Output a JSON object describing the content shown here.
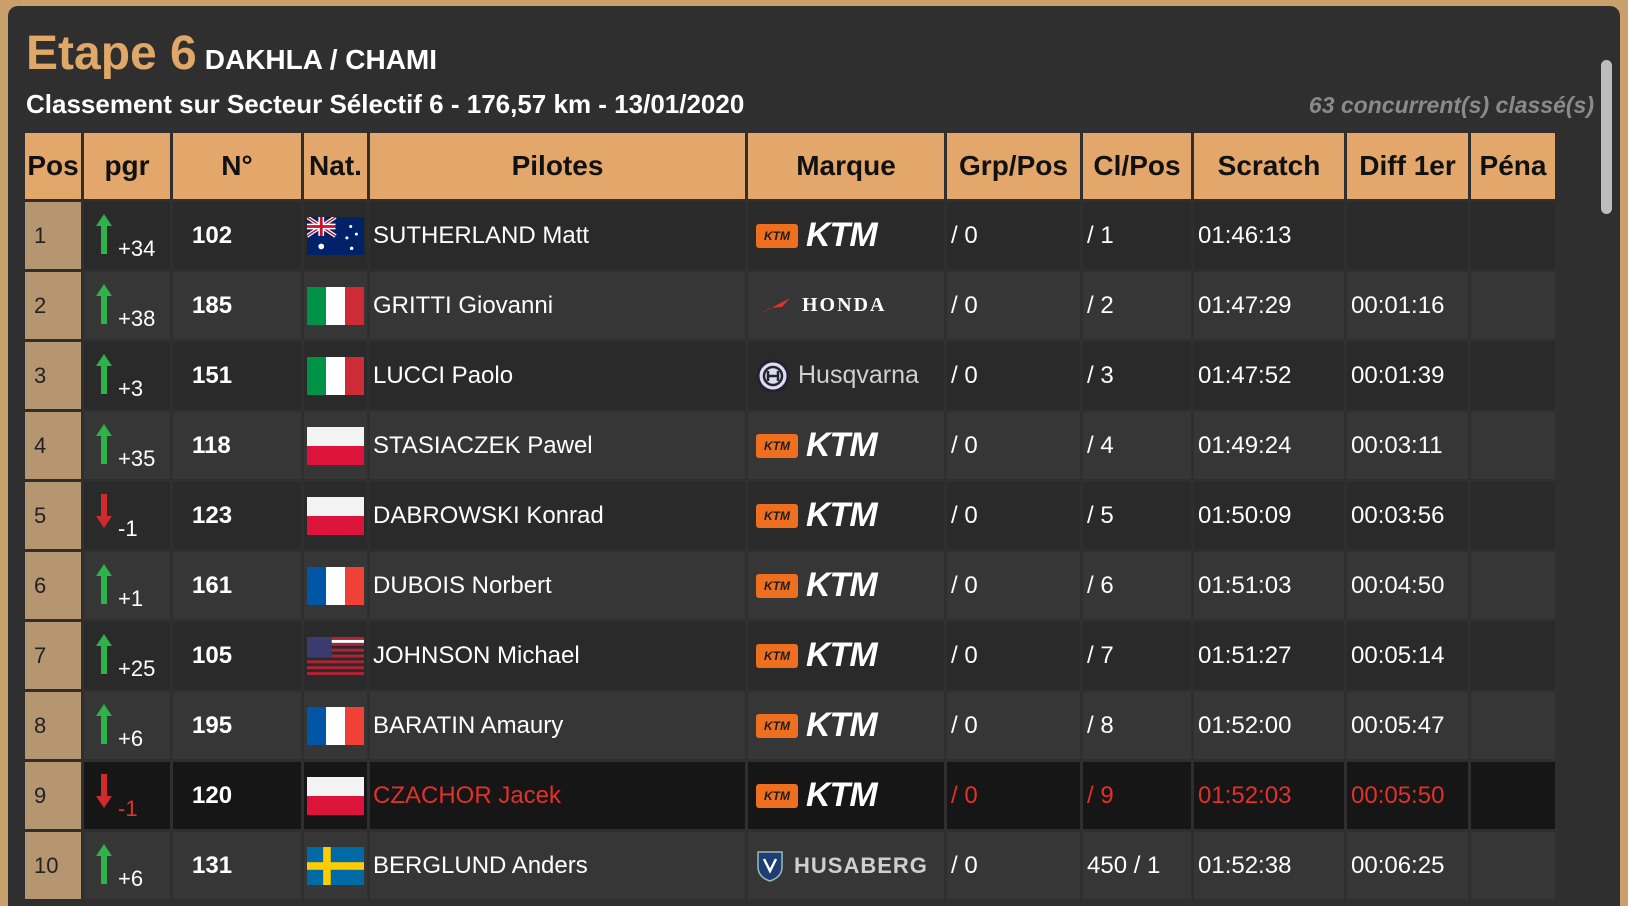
{
  "header": {
    "etape": "Etape 6",
    "route": "DAKHLA / CHAMI",
    "subtitle": "Classement sur Secteur Sélectif 6 - 176,57 km - 13/01/2020",
    "count": "63 concurrent(s) classé(s)"
  },
  "columns": [
    "Pos",
    "pgr",
    "N°",
    "Nat.",
    "Pilotes",
    "Marque",
    "Grp/Pos",
    "Cl/Pos",
    "Scratch",
    "Diff 1er",
    "Péna"
  ],
  "colors": {
    "accent": "#e3a76b",
    "up": "#2db34a",
    "down": "#d12a2a",
    "highlight_text": "#e3302b"
  },
  "rows": [
    {
      "pos": "1",
      "dir": "up",
      "delta": "+34",
      "no": "102",
      "nat": "australia-flag-icon",
      "pilot": "SUTHERLAND Matt",
      "brand": "KTM",
      "grp": "/ 0",
      "cl": "/ 1",
      "scratch": "01:46:13",
      "diff": "",
      "pena": ""
    },
    {
      "pos": "2",
      "dir": "up",
      "delta": "+38",
      "no": "185",
      "nat": "italy-flag-icon",
      "pilot": "GRITTI Giovanni",
      "brand": "HONDA",
      "grp": "/ 0",
      "cl": "/ 2",
      "scratch": "01:47:29",
      "diff": "00:01:16",
      "pena": ""
    },
    {
      "pos": "3",
      "dir": "up",
      "delta": "+3",
      "no": "151",
      "nat": "italy-flag-icon",
      "pilot": "LUCCI Paolo",
      "brand": "Husqvarna",
      "grp": "/ 0",
      "cl": "/ 3",
      "scratch": "01:47:52",
      "diff": "00:01:39",
      "pena": ""
    },
    {
      "pos": "4",
      "dir": "up",
      "delta": "+35",
      "no": "118",
      "nat": "poland-flag-icon",
      "pilot": "STASIACZEK Pawel",
      "brand": "KTM",
      "grp": "/ 0",
      "cl": "/ 4",
      "scratch": "01:49:24",
      "diff": "00:03:11",
      "pena": ""
    },
    {
      "pos": "5",
      "dir": "down",
      "delta": "-1",
      "no": "123",
      "nat": "poland-flag-icon",
      "pilot": "DABROWSKI Konrad",
      "brand": "KTM",
      "grp": "/ 0",
      "cl": "/ 5",
      "scratch": "01:50:09",
      "diff": "00:03:56",
      "pena": ""
    },
    {
      "pos": "6",
      "dir": "up",
      "delta": "+1",
      "no": "161",
      "nat": "france-flag-icon",
      "pilot": "DUBOIS Norbert",
      "brand": "KTM",
      "grp": "/ 0",
      "cl": "/ 6",
      "scratch": "01:51:03",
      "diff": "00:04:50",
      "pena": ""
    },
    {
      "pos": "7",
      "dir": "up",
      "delta": "+25",
      "no": "105",
      "nat": "usa-flag-icon",
      "pilot": "JOHNSON Michael",
      "brand": "KTM",
      "grp": "/ 0",
      "cl": "/ 7",
      "scratch": "01:51:27",
      "diff": "00:05:14",
      "pena": ""
    },
    {
      "pos": "8",
      "dir": "up",
      "delta": "+6",
      "no": "195",
      "nat": "france-flag-icon",
      "pilot": "BARATIN Amaury",
      "brand": "KTM",
      "grp": "/ 0",
      "cl": "/ 8",
      "scratch": "01:52:00",
      "diff": "00:05:47",
      "pena": ""
    },
    {
      "pos": "9",
      "dir": "down",
      "delta": "-1",
      "no": "120",
      "nat": "poland-flag-icon",
      "pilot": "CZACHOR Jacek",
      "brand": "KTM",
      "grp": "/ 0",
      "cl": "/ 9",
      "scratch": "01:52:03",
      "diff": "00:05:50",
      "pena": "",
      "highlight": true
    },
    {
      "pos": "10",
      "dir": "up",
      "delta": "+6",
      "no": "131",
      "nat": "sweden-flag-icon",
      "pilot": "BERGLUND Anders",
      "brand": "HUSABERG",
      "grp": "/ 0",
      "cl": "450 / 1",
      "scratch": "01:52:38",
      "diff": "00:06:25",
      "pena": ""
    }
  ]
}
